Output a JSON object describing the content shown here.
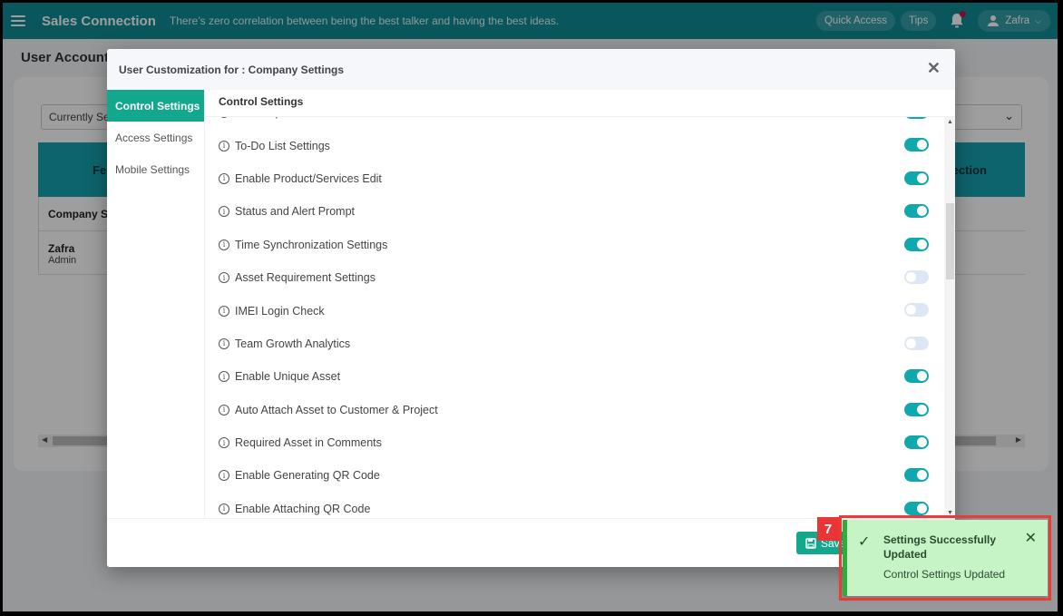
{
  "topbar": {
    "app_name": "Sales Connection",
    "quote": "There’s zero correlation between being the best talker and having the best ideas.",
    "quick_access_label": "Quick Access",
    "tips_label": "Tips",
    "user_name": "Zafra",
    "notification_dot_color": "#c2185b",
    "brand_color": "#0f8d97"
  },
  "background_page": {
    "title": "User Account",
    "select_value": "Currently Se",
    "table": {
      "header_left": "Fe",
      "header_right": "ection",
      "rows": [
        {
          "name": "Company Se",
          "sub": ""
        },
        {
          "name": "Zafra",
          "sub": "Admin"
        }
      ]
    }
  },
  "modal": {
    "title": "User Customization for : Company Settings",
    "sidebar": [
      {
        "label": "Control Settings",
        "active": true
      },
      {
        "label": "Access Settings",
        "active": false
      },
      {
        "label": "Mobile Settings",
        "active": false
      }
    ],
    "section_title": "Control Settings",
    "settings": [
      {
        "label": "Data Export Access",
        "enabled": true
      },
      {
        "label": "To-Do List Settings",
        "enabled": true
      },
      {
        "label": "Enable Product/Services Edit",
        "enabled": true
      },
      {
        "label": "Status and Alert Prompt",
        "enabled": true
      },
      {
        "label": "Time Synchronization Settings",
        "enabled": true
      },
      {
        "label": "Asset Requirement Settings",
        "enabled": false
      },
      {
        "label": "IMEI Login Check",
        "enabled": false
      },
      {
        "label": "Team Growth Analytics",
        "enabled": false
      },
      {
        "label": "Enable Unique Asset",
        "enabled": true
      },
      {
        "label": "Auto Attach Asset to Customer & Project",
        "enabled": true
      },
      {
        "label": "Required Asset in Comments",
        "enabled": true
      },
      {
        "label": "Enable Generating QR Code",
        "enabled": true
      },
      {
        "label": "Enable Attaching QR Code",
        "enabled": true
      }
    ],
    "info_icon_glyph": "i",
    "save_button_label": "Save Control Settings",
    "accent_color": "#13a88e"
  },
  "toast": {
    "title": "Settings Successfully Updated",
    "message": "Control Settings Updated",
    "check_glyph": "✓",
    "close_glyph": "✕"
  },
  "annotation": {
    "step_number": "7"
  }
}
